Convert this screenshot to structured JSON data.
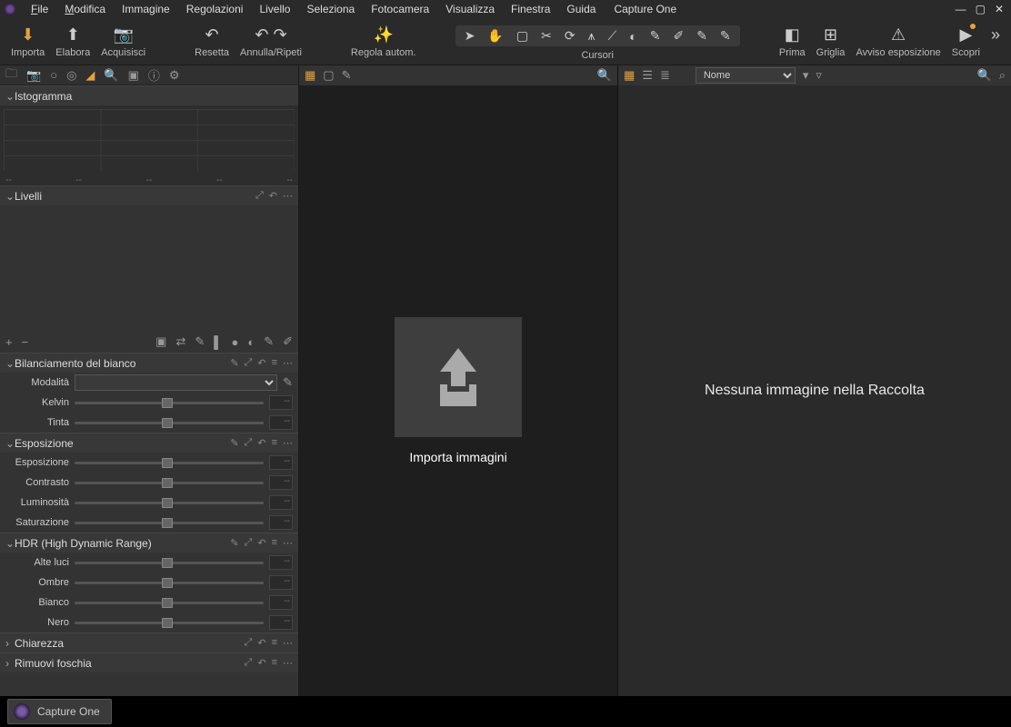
{
  "app_name": "Capture One",
  "menu": [
    "File",
    "Modifica",
    "Immagine",
    "Regolazioni",
    "Livello",
    "Seleziona",
    "Fotocamera",
    "Visualizza",
    "Finestra",
    "Guida"
  ],
  "toolbar": {
    "importa": "Importa",
    "elabora": "Elabora",
    "acquisisci": "Acquisisci",
    "resetta": "Resetta",
    "annulla": "Annulla/Ripeti",
    "regola_auto": "Regola autom.",
    "cursori": "Cursori",
    "prima": "Prima",
    "griglia": "Griglia",
    "avviso": "Avviso esposizione",
    "scopri": "Scopri"
  },
  "panels": {
    "istogramma": "Istogramma",
    "livelli": "Livelli",
    "bilanciamento": "Bilanciamento del bianco",
    "esposizione": "Esposizione",
    "hdr": "HDR (High Dynamic Range)",
    "chiarezza": "Chiarezza",
    "rimuovi_foschia": "Rimuovi foschia"
  },
  "wb": {
    "modalita": "Modalità",
    "kelvin": "Kelvin",
    "tinta": "Tinta"
  },
  "expo": {
    "esposizione": "Esposizione",
    "contrasto": "Contrasto",
    "luminosita": "Luminosità",
    "saturazione": "Saturazione"
  },
  "hdr": {
    "alte_luci": "Alte luci",
    "ombre": "Ombre",
    "bianco": "Bianco",
    "nero": "Nero"
  },
  "hist_ticks": {
    "a": "--",
    "b": "--",
    "c": "--",
    "d": "--",
    "e": "--"
  },
  "val_dash": "--",
  "viewer": {
    "import_box": "Importa immagini"
  },
  "browser": {
    "sort_by": "Nome",
    "empty": "Nessuna immagine nella Raccolta"
  },
  "taskbar": {
    "app": "Capture One"
  }
}
